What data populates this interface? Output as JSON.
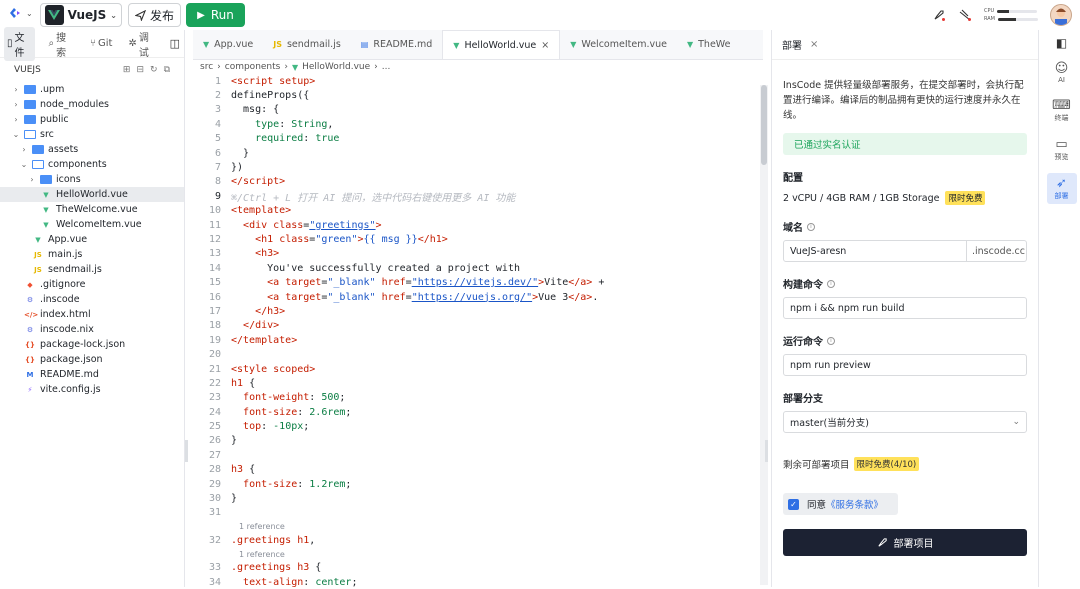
{
  "topbar": {
    "project": "VueJS",
    "publish": "发布",
    "run": "Run",
    "cpu_label": "CPU",
    "ram_label": "RAM",
    "cpu_level": 0.3,
    "ram_level": 0.45
  },
  "sidebar": {
    "tabs": [
      "文件",
      "搜索",
      "Git",
      "调试"
    ],
    "root": "VUEJS",
    "tree": [
      {
        "depth": 0,
        "kind": "folder",
        "chev": "›",
        "label": ".upm"
      },
      {
        "depth": 0,
        "kind": "folder",
        "chev": "›",
        "label": "node_modules"
      },
      {
        "depth": 0,
        "kind": "folder",
        "chev": "›",
        "label": "public"
      },
      {
        "depth": 0,
        "kind": "folder-open",
        "chev": "⌄",
        "label": "src"
      },
      {
        "depth": 1,
        "kind": "folder",
        "chev": "›",
        "label": "assets"
      },
      {
        "depth": 1,
        "kind": "folder-open",
        "chev": "⌄",
        "label": "components"
      },
      {
        "depth": 2,
        "kind": "folder",
        "chev": "›",
        "label": "icons"
      },
      {
        "depth": 2,
        "kind": "vue",
        "chev": "",
        "label": "HelloWorld.vue",
        "selected": true
      },
      {
        "depth": 2,
        "kind": "vue",
        "chev": "",
        "label": "TheWelcome.vue"
      },
      {
        "depth": 2,
        "kind": "vue",
        "chev": "",
        "label": "WelcomeItem.vue"
      },
      {
        "depth": 1,
        "kind": "vue",
        "chev": "",
        "label": "App.vue"
      },
      {
        "depth": 1,
        "kind": "js",
        "chev": "",
        "label": "main.js"
      },
      {
        "depth": 1,
        "kind": "js",
        "chev": "",
        "label": "sendmail.js"
      },
      {
        "depth": 0,
        "kind": "git",
        "chev": "",
        "label": ".gitignore"
      },
      {
        "depth": 0,
        "kind": "gear",
        "chev": "",
        "label": ".inscode"
      },
      {
        "depth": 0,
        "kind": "html",
        "chev": "",
        "label": "index.html"
      },
      {
        "depth": 0,
        "kind": "gear",
        "chev": "",
        "label": "inscode.nix"
      },
      {
        "depth": 0,
        "kind": "json",
        "chev": "",
        "label": "package-lock.json"
      },
      {
        "depth": 0,
        "kind": "json",
        "chev": "",
        "label": "package.json"
      },
      {
        "depth": 0,
        "kind": "md",
        "chev": "",
        "label": "README.md"
      },
      {
        "depth": 0,
        "kind": "vite",
        "chev": "",
        "label": "vite.config.js"
      }
    ]
  },
  "editor": {
    "tabs": [
      {
        "label": "App.vue",
        "icon": "vue"
      },
      {
        "label": "sendmail.js",
        "icon": "js"
      },
      {
        "label": "README.md",
        "icon": "md"
      },
      {
        "label": "HelloWorld.vue",
        "icon": "vue",
        "active": true
      },
      {
        "label": "WelcomeItem.vue",
        "icon": "vue"
      },
      {
        "label": "TheWe",
        "icon": "vue"
      }
    ],
    "breadcrumb": [
      "src",
      "components",
      "HelloWorld.vue",
      "..."
    ],
    "reference": "1 reference",
    "lines": [
      {
        "n": "1",
        "html": "<span class='k'>&lt;script setup&gt;</span>"
      },
      {
        "n": "2",
        "html": "defineProps({"
      },
      {
        "n": "3",
        "html": "  msg: {"
      },
      {
        "n": "4",
        "html": "    <span class='s'>type</span>: <span class='s'>String</span>,"
      },
      {
        "n": "5",
        "html": "    <span class='s'>required</span>: <span class='s'>true</span>"
      },
      {
        "n": "6",
        "html": "  }"
      },
      {
        "n": "7",
        "html": "})"
      },
      {
        "n": "8",
        "html": "<span class='k'>&lt;/script&gt;</span>"
      },
      {
        "n": "9",
        "html": "<span class='hint'>⌘/Ctrl + L 打开 AI 提问，选中代码右键使用更多 AI 功能</span>",
        "cur": true
      },
      {
        "n": "10",
        "html": "<span class='k'>&lt;template&gt;</span>"
      },
      {
        "n": "11",
        "html": "  <span class='k'>&lt;div</span> <span class='t'>class</span>=<span class='u'>\"greetings\"</span><span class='k'>&gt;</span>"
      },
      {
        "n": "12",
        "html": "    <span class='k'>&lt;h1</span> <span class='t'>class</span>=<span class='a'>\"green\"</span><span class='k'>&gt;</span><span class='a'>{{ msg }}</span><span class='k'>&lt;/h1&gt;</span>"
      },
      {
        "n": "13",
        "html": "    <span class='k'>&lt;h3&gt;</span>"
      },
      {
        "n": "14",
        "html": "      You've successfully created a project with"
      },
      {
        "n": "15",
        "html": "      <span class='k'>&lt;a</span> <span class='t'>target</span>=<span class='a'>\"_blank\"</span> <span class='t'>href</span>=<span class='u'>\"https://vitejs.dev/\"</span><span class='k'>&gt;</span>Vite<span class='k'>&lt;/a&gt;</span> +"
      },
      {
        "n": "16",
        "html": "      <span class='k'>&lt;a</span> <span class='t'>target</span>=<span class='a'>\"_blank\"</span> <span class='t'>href</span>=<span class='u'>\"https://vuejs.org/\"</span><span class='k'>&gt;</span>Vue 3<span class='k'>&lt;/a&gt;</span>."
      },
      {
        "n": "17",
        "html": "    <span class='k'>&lt;/h3&gt;</span>"
      },
      {
        "n": "18",
        "html": "  <span class='k'>&lt;/div&gt;</span>"
      },
      {
        "n": "19",
        "html": "<span class='k'>&lt;/template&gt;</span>"
      },
      {
        "n": "20",
        "html": ""
      },
      {
        "n": "21",
        "html": "<span class='k'>&lt;style scoped&gt;</span>"
      },
      {
        "n": "22",
        "html": "<span class='k'>h1</span> {"
      },
      {
        "n": "23",
        "html": "  <span class='k'>font-weight</span>: <span class='n'>500</span>;"
      },
      {
        "n": "24",
        "html": "  <span class='k'>font-size</span>: <span class='n'>2.6rem</span>;"
      },
      {
        "n": "25",
        "html": "  <span class='k'>top</span>: <span class='n'>-10px</span>;"
      },
      {
        "n": "26",
        "html": "}"
      },
      {
        "n": "27",
        "html": ""
      },
      {
        "n": "28",
        "html": "<span class='k'>h3</span> {"
      },
      {
        "n": "29",
        "html": "  <span class='k'>font-size</span>: <span class='n'>1.2rem</span>;"
      },
      {
        "n": "30",
        "html": "}"
      },
      {
        "n": "31",
        "html": ""
      },
      {
        "n": "32",
        "html": "<span class='k'>.greetings h1</span>,",
        "ref": true
      },
      {
        "n": "33",
        "html": "<span class='k'>.greetings h3</span> {",
        "ref": true
      },
      {
        "n": "34",
        "html": "  <span class='k'>text-align</span>: <span class='n'>center</span>;"
      }
    ]
  },
  "deploy": {
    "title": "部署",
    "description": "InsCode 提供轻量级部署服务，在提交部署时，会执行配置进行编译。编译后的制品拥有更快的运行速度并永久在线。",
    "verified": "已通过实名认证",
    "config_label": "配置",
    "config_value": "2 vCPU / 4GB RAM / 1GB Storage",
    "free_tag": "限时免费",
    "domain_label": "域名",
    "domain_value": "VueJS-aresn",
    "domain_suffix": ".inscode.cc",
    "build_label": "构建命令",
    "build_value": "npm i && npm run build",
    "run_label": "运行命令",
    "run_value": "npm run preview",
    "branch_label": "部署分支",
    "branch_value": "master(当前分支)",
    "remain_label": "剩余可部署项目",
    "remain_tag": "限时免费(4/10)",
    "agree_prefix": "同意",
    "agree_link": "《服务条款》",
    "deploy_button": "部署项目"
  },
  "rail": [
    {
      "label": "AI",
      "icon": "robot"
    },
    {
      "label": "终端",
      "icon": "terminal"
    },
    {
      "label": "预览",
      "icon": "monitor"
    },
    {
      "label": "部署",
      "icon": "rocket",
      "active": true
    }
  ],
  "colors": {
    "run": "#1aa35a",
    "accent": "#2f6fe4",
    "deploy_button": "#1c2233",
    "tag": "#ffe15a"
  }
}
